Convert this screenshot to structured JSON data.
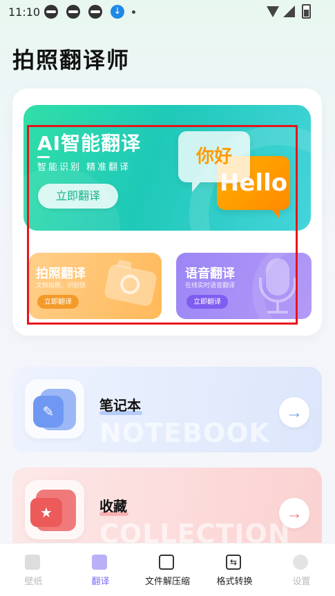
{
  "status_bar": {
    "time": "11:10"
  },
  "page_title": "拍照翻译师",
  "ai_card": {
    "title": "AI智能翻译",
    "subtitle": "智能识别 精准翻译",
    "button": "立即翻译",
    "bubble_hi": "你好",
    "bubble_hello": "Hello"
  },
  "photo_card": {
    "title": "拍照翻译",
    "subtitle": "文档拍照，识别快",
    "button": "立即翻译"
  },
  "voice_card": {
    "title": "语音翻译",
    "subtitle": "在线实时语音翻译",
    "button": "立即翻译"
  },
  "notebook": {
    "title": "笔记本",
    "bg_text": "NOTEBOOK"
  },
  "collection": {
    "title": "收藏",
    "bg_text": "COLLECTION"
  },
  "bottom_nav": [
    {
      "label": "壁纸",
      "icon": "wallpaper-icon",
      "state": "dim"
    },
    {
      "label": "翻译",
      "icon": "translate-icon",
      "state": "active"
    },
    {
      "label": "文件解压缩",
      "icon": "zip-icon",
      "state": "normal"
    },
    {
      "label": "格式转换",
      "icon": "convert-icon",
      "state": "normal"
    },
    {
      "label": "设置",
      "icon": "settings-icon",
      "state": "dim"
    }
  ],
  "colors": {
    "accent": "#7b6ef2",
    "ai_card": "#30dfa7",
    "photo_card": "#ffb95a",
    "voice_card": "#9c86f5",
    "highlight_box": "#e8141b"
  }
}
